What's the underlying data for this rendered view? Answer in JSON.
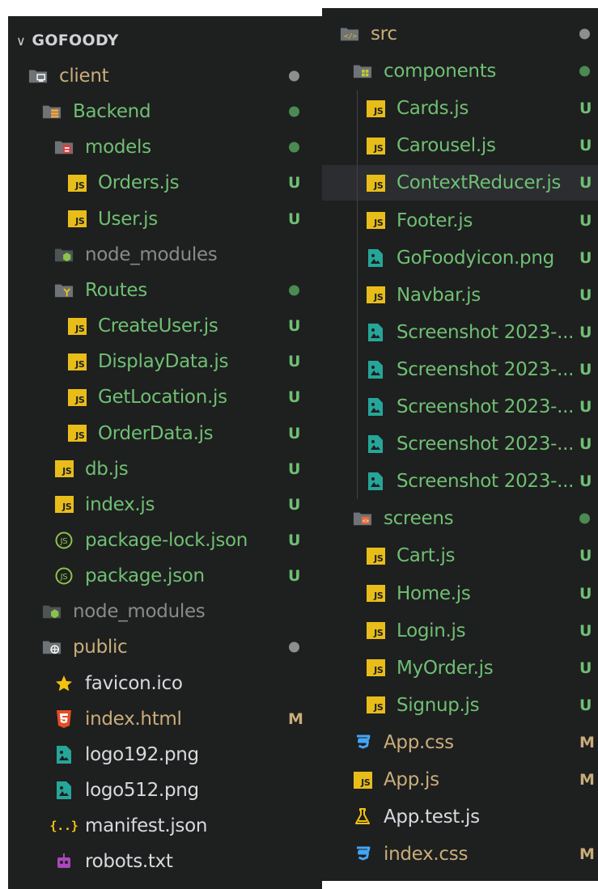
{
  "colors": {
    "panel_bg": "#1e1f1f",
    "untracked_green": "#6fbf73",
    "modified_gold": "#c9ad7a",
    "ignored_gray": "#8a8a8a",
    "default_text": "#d7dade",
    "dot_green": "#4b8a52",
    "dot_gray": "#8e8e8e"
  },
  "explorer": {
    "root_title": "GOFOODY",
    "left_items": [
      {
        "label": "client",
        "icon": "folder-client-icon",
        "status": "",
        "dot": "gray",
        "color": "modified"
      },
      {
        "label": "Backend",
        "icon": "folder-backend-icon",
        "status": "",
        "dot": "green",
        "color": "untracked"
      },
      {
        "label": "models",
        "icon": "folder-models-icon",
        "status": "",
        "dot": "green",
        "color": "untracked"
      },
      {
        "label": "Orders.js",
        "icon": "js-icon",
        "status": "U",
        "dot": "",
        "color": "untracked"
      },
      {
        "label": "User.js",
        "icon": "js-icon",
        "status": "U",
        "dot": "",
        "color": "untracked"
      },
      {
        "label": "node_modules",
        "icon": "folder-node-icon",
        "status": "",
        "dot": "",
        "color": "ignored"
      },
      {
        "label": "Routes",
        "icon": "folder-routes-icon",
        "status": "",
        "dot": "green",
        "color": "untracked"
      },
      {
        "label": "CreateUser.js",
        "icon": "js-icon",
        "status": "U",
        "dot": "",
        "color": "untracked"
      },
      {
        "label": "DisplayData.js",
        "icon": "js-icon",
        "status": "U",
        "dot": "",
        "color": "untracked"
      },
      {
        "label": "GetLocation.js",
        "icon": "js-icon",
        "status": "U",
        "dot": "",
        "color": "untracked"
      },
      {
        "label": "OrderData.js",
        "icon": "js-icon",
        "status": "U",
        "dot": "",
        "color": "untracked"
      },
      {
        "label": "db.js",
        "icon": "js-icon",
        "status": "U",
        "dot": "",
        "color": "untracked"
      },
      {
        "label": "index.js",
        "icon": "js-icon",
        "status": "U",
        "dot": "",
        "color": "untracked"
      },
      {
        "label": "package-lock.json",
        "icon": "nodejs-json-icon",
        "status": "U",
        "dot": "",
        "color": "untracked"
      },
      {
        "label": "package.json",
        "icon": "nodejs-json-icon",
        "status": "U",
        "dot": "",
        "color": "untracked"
      },
      {
        "label": "node_modules",
        "icon": "folder-node-icon",
        "status": "",
        "dot": "",
        "color": "ignored"
      },
      {
        "label": "public",
        "icon": "folder-public-icon",
        "status": "",
        "dot": "gray",
        "color": "modified"
      },
      {
        "label": "favicon.ico",
        "icon": "star-icon",
        "status": "",
        "dot": "",
        "color": "default"
      },
      {
        "label": "index.html",
        "icon": "html5-icon",
        "status": "M",
        "dot": "",
        "color": "modified"
      },
      {
        "label": "logo192.png",
        "icon": "image-icon",
        "status": "",
        "dot": "",
        "color": "default"
      },
      {
        "label": "logo512.png",
        "icon": "image-icon",
        "status": "",
        "dot": "",
        "color": "default"
      },
      {
        "label": "manifest.json",
        "icon": "json-braces-icon",
        "status": "",
        "dot": "",
        "color": "default"
      },
      {
        "label": "robots.txt",
        "icon": "robot-icon",
        "status": "",
        "dot": "",
        "color": "default"
      }
    ],
    "right_items": [
      {
        "label": "src",
        "icon": "folder-src-icon",
        "status": "",
        "dot": "gray",
        "color": "modified"
      },
      {
        "label": "components",
        "icon": "folder-components-icon",
        "status": "",
        "dot": "green",
        "color": "untracked"
      },
      {
        "label": "Cards.js",
        "icon": "js-icon",
        "status": "U",
        "dot": "",
        "color": "untracked"
      },
      {
        "label": "Carousel.js",
        "icon": "js-icon",
        "status": "U",
        "dot": "",
        "color": "untracked"
      },
      {
        "label": "ContextReducer.js",
        "icon": "js-icon",
        "status": "U",
        "dot": "",
        "color": "untracked",
        "selected": true
      },
      {
        "label": "Footer.js",
        "icon": "js-icon",
        "status": "U",
        "dot": "",
        "color": "untracked"
      },
      {
        "label": "GoFoodyicon.png",
        "icon": "image-icon",
        "status": "U",
        "dot": "",
        "color": "untracked"
      },
      {
        "label": "Navbar.js",
        "icon": "js-icon",
        "status": "U",
        "dot": "",
        "color": "untracked"
      },
      {
        "label": "Screenshot 2023-...",
        "icon": "image-icon",
        "status": "U",
        "dot": "",
        "color": "untracked"
      },
      {
        "label": "Screenshot 2023-...",
        "icon": "image-icon",
        "status": "U",
        "dot": "",
        "color": "untracked"
      },
      {
        "label": "Screenshot 2023-...",
        "icon": "image-icon",
        "status": "U",
        "dot": "",
        "color": "untracked"
      },
      {
        "label": "Screenshot 2023-...",
        "icon": "image-icon",
        "status": "U",
        "dot": "",
        "color": "untracked"
      },
      {
        "label": "Screenshot 2023-...",
        "icon": "image-icon",
        "status": "U",
        "dot": "",
        "color": "untracked"
      },
      {
        "label": "screens",
        "icon": "folder-screens-icon",
        "status": "",
        "dot": "green",
        "color": "untracked"
      },
      {
        "label": "Cart.js",
        "icon": "js-icon",
        "status": "U",
        "dot": "",
        "color": "untracked"
      },
      {
        "label": "Home.js",
        "icon": "js-icon",
        "status": "U",
        "dot": "",
        "color": "untracked"
      },
      {
        "label": "Login.js",
        "icon": "js-icon",
        "status": "U",
        "dot": "",
        "color": "untracked"
      },
      {
        "label": "MyOrder.js",
        "icon": "js-icon",
        "status": "U",
        "dot": "",
        "color": "untracked"
      },
      {
        "label": "Signup.js",
        "icon": "js-icon",
        "status": "U",
        "dot": "",
        "color": "untracked"
      },
      {
        "label": "App.css",
        "icon": "css3-icon",
        "status": "M",
        "dot": "",
        "color": "modified"
      },
      {
        "label": "App.js",
        "icon": "js-icon",
        "status": "M",
        "dot": "",
        "color": "modified"
      },
      {
        "label": "App.test.js",
        "icon": "flask-test-icon",
        "status": "",
        "dot": "",
        "color": "default"
      },
      {
        "label": "index.css",
        "icon": "css3-icon",
        "status": "M",
        "dot": "",
        "color": "modified"
      }
    ]
  }
}
